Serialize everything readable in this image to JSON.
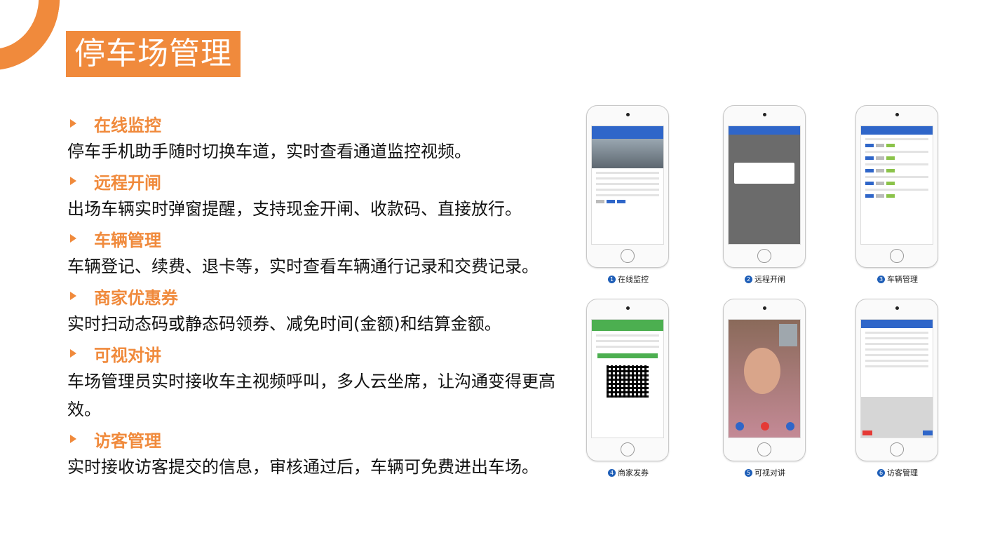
{
  "slide": {
    "title": "停车场管理"
  },
  "features": [
    {
      "title": "在线监控",
      "desc": "停车手机助手随时切换车道，实时查看通道监控视频。"
    },
    {
      "title": "远程开闸",
      "desc": "出场车辆实时弹窗提醒，支持现金开闸、收款码、直接放行。"
    },
    {
      "title": "车辆管理",
      "desc": "车辆登记、续费、退卡等，实时查看车辆通行记录和交费记录。"
    },
    {
      "title": "商家优惠券",
      "desc": "实时扫动态码或静态码领券、减免时间(金额)和结算金额。"
    },
    {
      "title": "可视对讲",
      "desc": "车场管理员实时接收车主视频呼叫，多人云坐席，让沟通变得更高效。"
    },
    {
      "title": "访客管理",
      "desc": "实时接收访客提交的信息，审核通过后，车辆可免费进出车场。"
    }
  ],
  "phones": [
    {
      "num": "1",
      "caption": "在线监控"
    },
    {
      "num": "2",
      "caption": "远程开闸"
    },
    {
      "num": "3",
      "caption": "车辆管理"
    },
    {
      "num": "4",
      "caption": "商家发券"
    },
    {
      "num": "5",
      "caption": "可视对讲"
    },
    {
      "num": "6",
      "caption": "访客管理"
    }
  ],
  "colors": {
    "accent": "#f08a3c",
    "caption_num": "#1f5fb8"
  }
}
